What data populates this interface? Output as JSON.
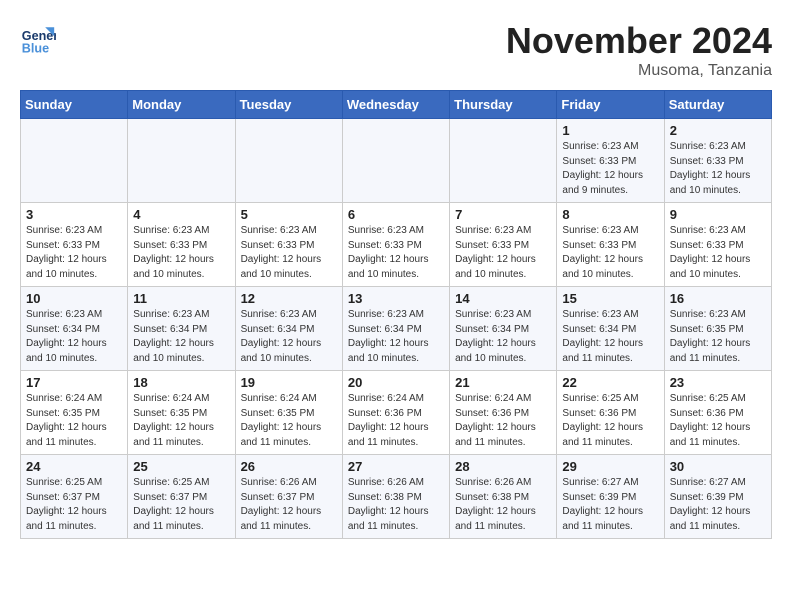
{
  "logo": {
    "line1": "General",
    "line2": "Blue"
  },
  "title": "November 2024",
  "location": "Musoma, Tanzania",
  "weekdays": [
    "Sunday",
    "Monday",
    "Tuesday",
    "Wednesday",
    "Thursday",
    "Friday",
    "Saturday"
  ],
  "weeks": [
    [
      {
        "day": "",
        "info": ""
      },
      {
        "day": "",
        "info": ""
      },
      {
        "day": "",
        "info": ""
      },
      {
        "day": "",
        "info": ""
      },
      {
        "day": "",
        "info": ""
      },
      {
        "day": "1",
        "info": "Sunrise: 6:23 AM\nSunset: 6:33 PM\nDaylight: 12 hours and 9 minutes."
      },
      {
        "day": "2",
        "info": "Sunrise: 6:23 AM\nSunset: 6:33 PM\nDaylight: 12 hours and 10 minutes."
      }
    ],
    [
      {
        "day": "3",
        "info": "Sunrise: 6:23 AM\nSunset: 6:33 PM\nDaylight: 12 hours and 10 minutes."
      },
      {
        "day": "4",
        "info": "Sunrise: 6:23 AM\nSunset: 6:33 PM\nDaylight: 12 hours and 10 minutes."
      },
      {
        "day": "5",
        "info": "Sunrise: 6:23 AM\nSunset: 6:33 PM\nDaylight: 12 hours and 10 minutes."
      },
      {
        "day": "6",
        "info": "Sunrise: 6:23 AM\nSunset: 6:33 PM\nDaylight: 12 hours and 10 minutes."
      },
      {
        "day": "7",
        "info": "Sunrise: 6:23 AM\nSunset: 6:33 PM\nDaylight: 12 hours and 10 minutes."
      },
      {
        "day": "8",
        "info": "Sunrise: 6:23 AM\nSunset: 6:33 PM\nDaylight: 12 hours and 10 minutes."
      },
      {
        "day": "9",
        "info": "Sunrise: 6:23 AM\nSunset: 6:33 PM\nDaylight: 12 hours and 10 minutes."
      }
    ],
    [
      {
        "day": "10",
        "info": "Sunrise: 6:23 AM\nSunset: 6:34 PM\nDaylight: 12 hours and 10 minutes."
      },
      {
        "day": "11",
        "info": "Sunrise: 6:23 AM\nSunset: 6:34 PM\nDaylight: 12 hours and 10 minutes."
      },
      {
        "day": "12",
        "info": "Sunrise: 6:23 AM\nSunset: 6:34 PM\nDaylight: 12 hours and 10 minutes."
      },
      {
        "day": "13",
        "info": "Sunrise: 6:23 AM\nSunset: 6:34 PM\nDaylight: 12 hours and 10 minutes."
      },
      {
        "day": "14",
        "info": "Sunrise: 6:23 AM\nSunset: 6:34 PM\nDaylight: 12 hours and 10 minutes."
      },
      {
        "day": "15",
        "info": "Sunrise: 6:23 AM\nSunset: 6:34 PM\nDaylight: 12 hours and 11 minutes."
      },
      {
        "day": "16",
        "info": "Sunrise: 6:23 AM\nSunset: 6:35 PM\nDaylight: 12 hours and 11 minutes."
      }
    ],
    [
      {
        "day": "17",
        "info": "Sunrise: 6:24 AM\nSunset: 6:35 PM\nDaylight: 12 hours and 11 minutes."
      },
      {
        "day": "18",
        "info": "Sunrise: 6:24 AM\nSunset: 6:35 PM\nDaylight: 12 hours and 11 minutes."
      },
      {
        "day": "19",
        "info": "Sunrise: 6:24 AM\nSunset: 6:35 PM\nDaylight: 12 hours and 11 minutes."
      },
      {
        "day": "20",
        "info": "Sunrise: 6:24 AM\nSunset: 6:36 PM\nDaylight: 12 hours and 11 minutes."
      },
      {
        "day": "21",
        "info": "Sunrise: 6:24 AM\nSunset: 6:36 PM\nDaylight: 12 hours and 11 minutes."
      },
      {
        "day": "22",
        "info": "Sunrise: 6:25 AM\nSunset: 6:36 PM\nDaylight: 12 hours and 11 minutes."
      },
      {
        "day": "23",
        "info": "Sunrise: 6:25 AM\nSunset: 6:36 PM\nDaylight: 12 hours and 11 minutes."
      }
    ],
    [
      {
        "day": "24",
        "info": "Sunrise: 6:25 AM\nSunset: 6:37 PM\nDaylight: 12 hours and 11 minutes."
      },
      {
        "day": "25",
        "info": "Sunrise: 6:25 AM\nSunset: 6:37 PM\nDaylight: 12 hours and 11 minutes."
      },
      {
        "day": "26",
        "info": "Sunrise: 6:26 AM\nSunset: 6:37 PM\nDaylight: 12 hours and 11 minutes."
      },
      {
        "day": "27",
        "info": "Sunrise: 6:26 AM\nSunset: 6:38 PM\nDaylight: 12 hours and 11 minutes."
      },
      {
        "day": "28",
        "info": "Sunrise: 6:26 AM\nSunset: 6:38 PM\nDaylight: 12 hours and 11 minutes."
      },
      {
        "day": "29",
        "info": "Sunrise: 6:27 AM\nSunset: 6:39 PM\nDaylight: 12 hours and 11 minutes."
      },
      {
        "day": "30",
        "info": "Sunrise: 6:27 AM\nSunset: 6:39 PM\nDaylight: 12 hours and 11 minutes."
      }
    ]
  ]
}
